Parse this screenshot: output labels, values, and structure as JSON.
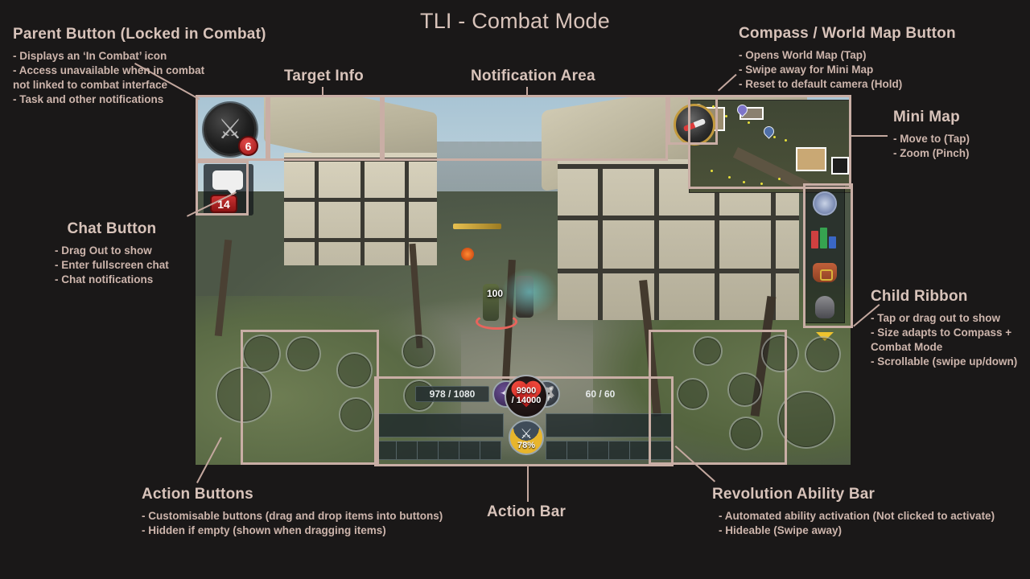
{
  "title": "TLI - Combat Mode",
  "colors": {
    "background": "#1a1818",
    "annotation_text": "#d2bcb3",
    "highlight_border": "#c9aea5",
    "badge_red": "#b22222",
    "adrenaline_gold": "#e8b52c"
  },
  "annotations": [
    {
      "id": "parent-button",
      "head": "Parent Button (Locked in Combat)",
      "bullets": [
        "- Displays an ‘In Combat’ icon",
        "- Access unavailable when in combat",
        "   not linked to combat interface",
        "- Task and other notifications"
      ]
    },
    {
      "id": "target-info",
      "head": "Target Info",
      "bullets": []
    },
    {
      "id": "notification-area",
      "head": "Notification Area",
      "bullets": []
    },
    {
      "id": "compass-world-map-button",
      "head": "Compass / World Map Button",
      "bullets": [
        "- Opens World Map (Tap)",
        "- Swipe away for Mini Map",
        "- Reset to default camera (Hold)"
      ]
    },
    {
      "id": "mini-map",
      "head": "Mini Map",
      "bullets": [
        "- Move to (Tap)",
        "- Zoom (Pinch)"
      ]
    },
    {
      "id": "child-ribbon",
      "head": "Child Ribbon",
      "bullets": [
        "- Tap or drag out to show",
        "- Size adapts to Compass +",
        "   Combat Mode",
        "- Scrollable (swipe up/down)"
      ]
    },
    {
      "id": "chat-button",
      "head": "Chat Button",
      "bullets": [
        "- Drag Out to show",
        "- Enter fullscreen chat",
        "- Chat notifications"
      ]
    },
    {
      "id": "action-buttons",
      "head": "Action Buttons",
      "bullets": [
        "- Customisable buttons (drag and drop items into buttons)",
        "- Hidden if empty (shown when dragging items)"
      ]
    },
    {
      "id": "action-bar",
      "head": "Action Bar",
      "bullets": []
    },
    {
      "id": "revolution-ability-bar",
      "head": "Revolution Ability Bar",
      "bullets": [
        "- Automated ability activation (Not clicked to activate)",
        "- Hideable (Swipe away)"
      ]
    }
  ],
  "hud": {
    "parent_button": {
      "icon": "crossed-swords-icon",
      "badge_count": "6"
    },
    "chat_button": {
      "icon": "speech-bubble-icon",
      "badge_count": "14"
    },
    "compass": {
      "icon": "compass-needle-icon"
    },
    "ribbon_items": [
      "compass-rose-icon",
      "books-icon",
      "backpack-icon",
      "helmet-icon",
      "scroll-down-arrow-icon"
    ],
    "action_bar": {
      "prayer": {
        "icon": "prayer-star-icon",
        "value": "978 / 1080"
      },
      "summoning": {
        "icon": "wolf-head-icon",
        "value": "60 / 60"
      },
      "health": {
        "icon": "heart-icon",
        "current": "9900",
        "max": "/ 14000"
      },
      "adrenaline": {
        "icon": "crossed-swords-icon",
        "value": "78%"
      }
    },
    "scene": {
      "damage_number": "100"
    }
  }
}
